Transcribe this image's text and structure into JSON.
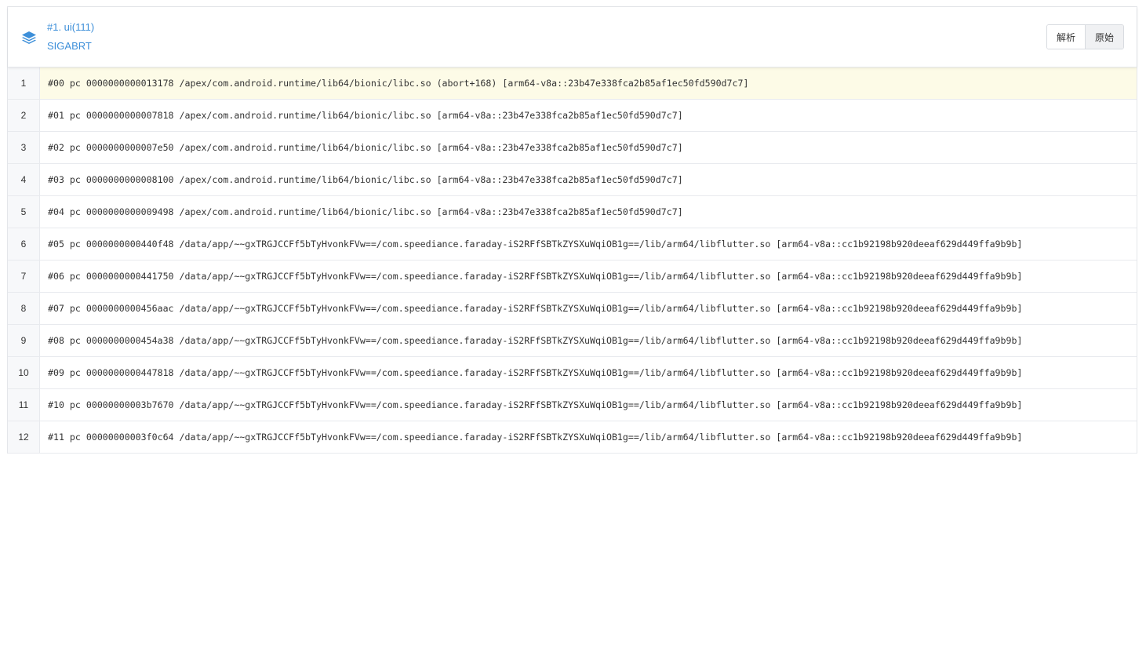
{
  "thread": {
    "title": "#1. ui(111)",
    "signal": "SIGABRT",
    "icon": "layers-icon"
  },
  "view_toggle": {
    "parsed_label": "解析",
    "raw_label": "原始",
    "active": "raw"
  },
  "colors": {
    "accent": "#3d8fd9",
    "highlight_row": "#fdfbe7"
  },
  "frames": [
    {
      "no": "1",
      "text": "#00 pc 0000000000013178 /apex/com.android.runtime/lib64/bionic/libc.so (abort+168) [arm64-v8a::23b47e338fca2b85af1ec50fd590d7c7]"
    },
    {
      "no": "2",
      "text": "#01 pc 0000000000007818 /apex/com.android.runtime/lib64/bionic/libc.so [arm64-v8a::23b47e338fca2b85af1ec50fd590d7c7]"
    },
    {
      "no": "3",
      "text": "#02 pc 0000000000007e50 /apex/com.android.runtime/lib64/bionic/libc.so [arm64-v8a::23b47e338fca2b85af1ec50fd590d7c7]"
    },
    {
      "no": "4",
      "text": "#03 pc 0000000000008100 /apex/com.android.runtime/lib64/bionic/libc.so [arm64-v8a::23b47e338fca2b85af1ec50fd590d7c7]"
    },
    {
      "no": "5",
      "text": "#04 pc 0000000000009498 /apex/com.android.runtime/lib64/bionic/libc.so [arm64-v8a::23b47e338fca2b85af1ec50fd590d7c7]"
    },
    {
      "no": "6",
      "text": "#05 pc 0000000000440f48 /data/app/~~gxTRGJCCFf5bTyHvonkFVw==/com.speediance.faraday-iS2RFfSBTkZYSXuWqiOB1g==/lib/arm64/libflutter.so [arm64-v8a::cc1b92198b920deeaf629d449ffa9b9b]"
    },
    {
      "no": "7",
      "text": "#06 pc 0000000000441750 /data/app/~~gxTRGJCCFf5bTyHvonkFVw==/com.speediance.faraday-iS2RFfSBTkZYSXuWqiOB1g==/lib/arm64/libflutter.so [arm64-v8a::cc1b92198b920deeaf629d449ffa9b9b]"
    },
    {
      "no": "8",
      "text": "#07 pc 0000000000456aac /data/app/~~gxTRGJCCFf5bTyHvonkFVw==/com.speediance.faraday-iS2RFfSBTkZYSXuWqiOB1g==/lib/arm64/libflutter.so [arm64-v8a::cc1b92198b920deeaf629d449ffa9b9b]"
    },
    {
      "no": "9",
      "text": "#08 pc 0000000000454a38 /data/app/~~gxTRGJCCFf5bTyHvonkFVw==/com.speediance.faraday-iS2RFfSBTkZYSXuWqiOB1g==/lib/arm64/libflutter.so [arm64-v8a::cc1b92198b920deeaf629d449ffa9b9b]"
    },
    {
      "no": "10",
      "text": "#09 pc 0000000000447818 /data/app/~~gxTRGJCCFf5bTyHvonkFVw==/com.speediance.faraday-iS2RFfSBTkZYSXuWqiOB1g==/lib/arm64/libflutter.so [arm64-v8a::cc1b92198b920deeaf629d449ffa9b9b]"
    },
    {
      "no": "11",
      "text": "#10 pc 00000000003b7670 /data/app/~~gxTRGJCCFf5bTyHvonkFVw==/com.speediance.faraday-iS2RFfSBTkZYSXuWqiOB1g==/lib/arm64/libflutter.so [arm64-v8a::cc1b92198b920deeaf629d449ffa9b9b]"
    },
    {
      "no": "12",
      "text": "#11 pc 00000000003f0c64 /data/app/~~gxTRGJCCFf5bTyHvonkFVw==/com.speediance.faraday-iS2RFfSBTkZYSXuWqiOB1g==/lib/arm64/libflutter.so [arm64-v8a::cc1b92198b920deeaf629d449ffa9b9b]"
    }
  ]
}
